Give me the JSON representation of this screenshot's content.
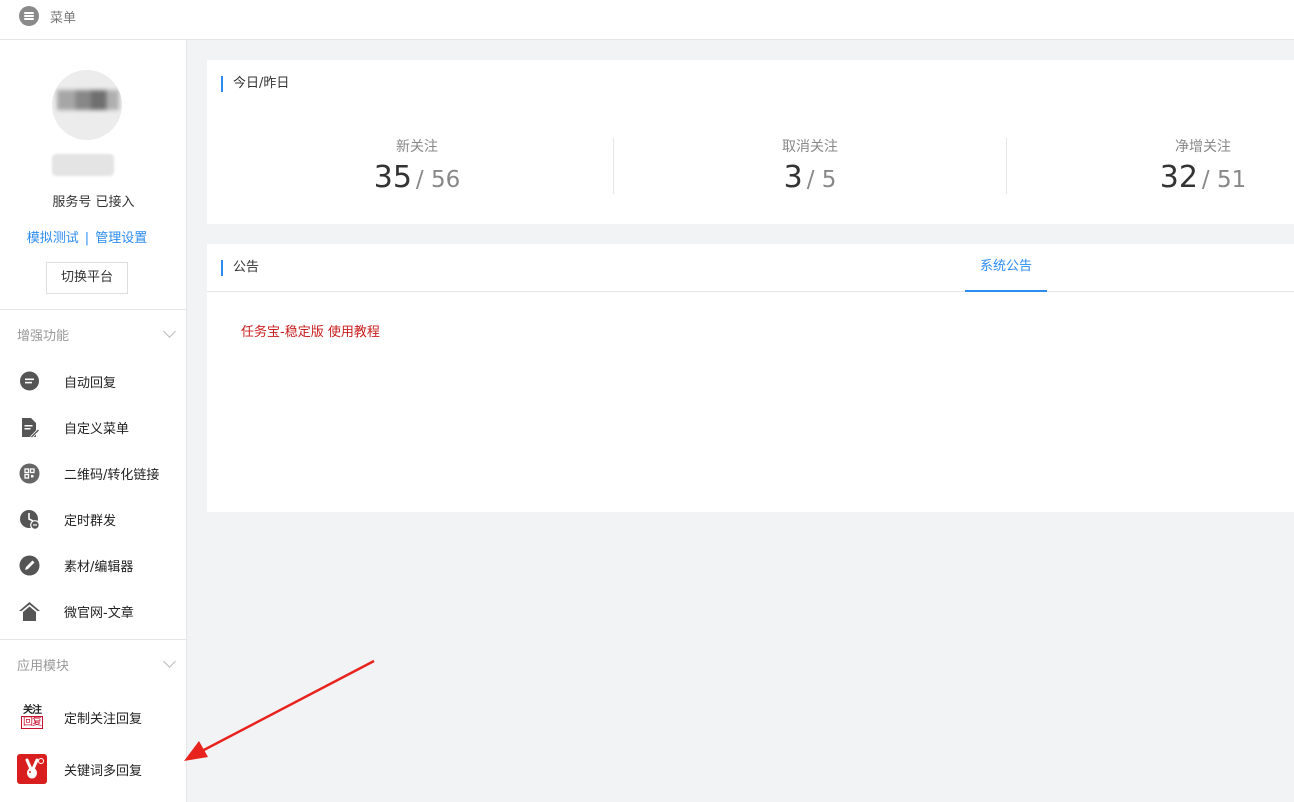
{
  "topbar": {
    "menu_label": "菜单"
  },
  "sidebar": {
    "account_status": "服务号 已接入",
    "links": {
      "test": "模拟测试",
      "separator": "|",
      "settings": "管理设置"
    },
    "switch_button": "切换平台",
    "enhanced": {
      "title": "增强功能",
      "items": [
        {
          "label": "自动回复",
          "icon": "chat-bubble-icon"
        },
        {
          "label": "自定义菜单",
          "icon": "document-edit-icon"
        },
        {
          "label": "二维码/转化链接",
          "icon": "qrcode-icon"
        },
        {
          "label": "定时群发",
          "icon": "clock-icon"
        },
        {
          "label": "素材/编辑器",
          "icon": "pencil-icon"
        },
        {
          "label": "微官网-文章",
          "icon": "home-icon"
        }
      ]
    },
    "apps": {
      "title": "应用模块",
      "items": [
        {
          "label": "定制关注回复",
          "icon_text_top": "关注",
          "icon_text_bottom": "回复"
        },
        {
          "label": "关键词多回复",
          "icon": "rabbit-logo-icon"
        }
      ]
    }
  },
  "stats": {
    "title": "今日/昨日",
    "items": [
      {
        "label": "新关注",
        "today": "35",
        "yesterday": "/ 56"
      },
      {
        "label": "取消关注",
        "today": "3",
        "yesterday": "/ 5"
      },
      {
        "label": "净增关注",
        "today": "32",
        "yesterday": "/ 51"
      }
    ]
  },
  "notice": {
    "title": "公告",
    "tab": "系统公告",
    "link": "任务宝-稳定版 使用教程"
  },
  "colors": {
    "accent": "#2d8cf0",
    "notice_link": "#c81d1d",
    "arrow": "#e8231e"
  }
}
